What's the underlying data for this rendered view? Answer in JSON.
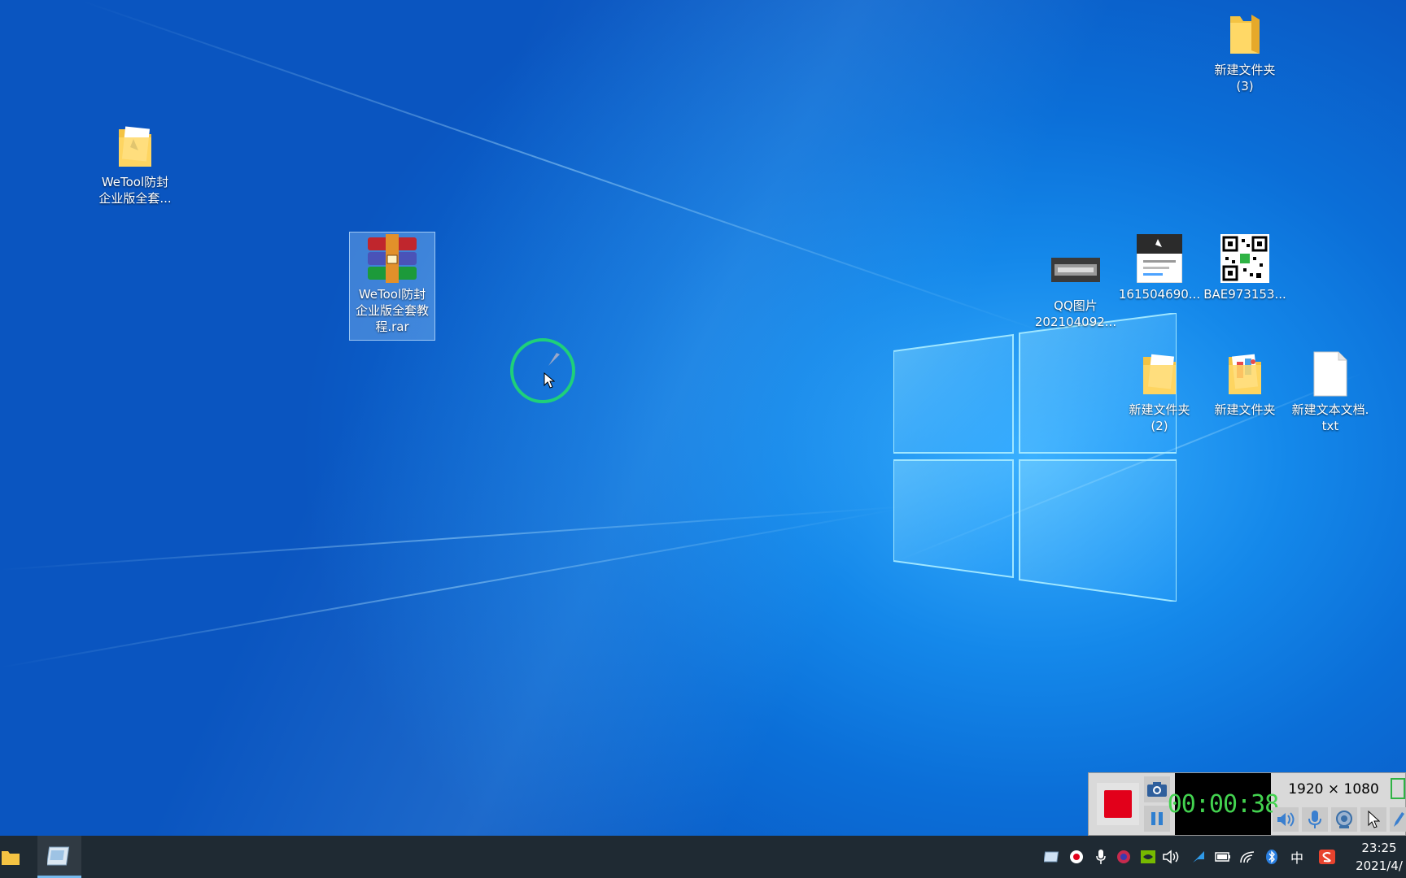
{
  "desktop_icons": [
    {
      "id": "folder-3",
      "label": "新建文件夹\n(3)",
      "kind": "folder"
    },
    {
      "id": "wetool-folder",
      "label": "WeTool防封\n企业版全套...",
      "kind": "folder-doc"
    },
    {
      "id": "wetool-rar",
      "label": "WeTool防封\n企业版全套教\n程.rar",
      "kind": "rar",
      "selected": true
    },
    {
      "id": "qq-image",
      "label": "QQ图片\n202104092...",
      "kind": "image-dark"
    },
    {
      "id": "screenshot-161",
      "label": "161504690...",
      "kind": "image-doc"
    },
    {
      "id": "qr-image",
      "label": "BAE973153...",
      "kind": "qrcode"
    },
    {
      "id": "folder-2",
      "label": "新建文件夹\n(2)",
      "kind": "folder-doc"
    },
    {
      "id": "folder-plain",
      "label": "新建文件夹",
      "kind": "folder-color"
    },
    {
      "id": "text-doc",
      "label": "新建文本文档.\ntxt",
      "kind": "txt"
    }
  ],
  "recorder": {
    "timer": "00:00:38",
    "resolution": "1920 × 1080"
  },
  "taskbar": {
    "ime": "中",
    "clock_time": "23:25",
    "clock_date": "2021/4/"
  },
  "colors": {
    "desktop_accent": "#1488ea",
    "taskbar_bg": "#1f2a33",
    "record_red": "#e2001a",
    "timer_green": "#43d24f",
    "cursor_ring": "#1fd07a"
  }
}
